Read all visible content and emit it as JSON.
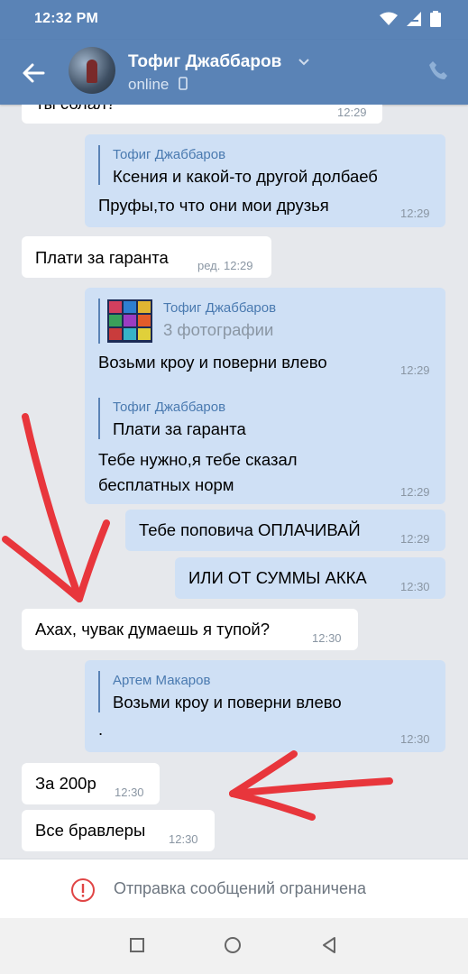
{
  "status_bar": {
    "time": "12:32 PM"
  },
  "header": {
    "name": "Тофиг Джаббаров",
    "status": "online"
  },
  "messages": {
    "m0": {
      "text": "ты сблал?",
      "time": "12:29"
    },
    "m1": {
      "quote_author": "Тофиг Джаббаров",
      "quote_text": "Ксения  и какой-то другой долбаеб",
      "text": "Пруфы,то что они мои друзья",
      "time": "12:29"
    },
    "m2": {
      "text": "Плати за гаранта",
      "time": "ред. 12:29"
    },
    "m3": {
      "quote_author": "Тофиг Джаббаров",
      "quote_text": "3 фотографии",
      "text": "Возьми кроу и поверни влево",
      "time": "12:29"
    },
    "m4": {
      "quote_author": "Тофиг Джаббаров",
      "quote_text": "Плати за гаранта",
      "text_line1": "Тебе нужно,я тебе сказал",
      "text_line2": "бесплатных норм",
      "time": "12:29"
    },
    "m5": {
      "text": "Тебе поповича ОПЛАЧИВАЙ",
      "time": "12:29"
    },
    "m6": {
      "text": "ИЛИ ОТ СУММЫ АККА",
      "time": "12:30"
    },
    "m7": {
      "text": "Ахах, чувак думаешь я тупой?",
      "time": "12:30"
    },
    "m8": {
      "quote_author": "Артем Макаров",
      "quote_text": "Возьми кроу и поверни влево",
      "text": ".",
      "time": "12:30"
    },
    "m9": {
      "text": "За 200р",
      "time": "12:30"
    },
    "m10": {
      "text": "Все бравлеры",
      "time": "12:30"
    }
  },
  "footer": {
    "restriction": "Отправка сообщений ограничена"
  },
  "colors": {
    "header": "#5a83b6",
    "outgoing_bubble": "#cfe0f5",
    "incoming_bubble": "#ffffff",
    "background": "#e6e8ec",
    "annotation_arrow": "#e8363c",
    "alert": "#e04545"
  },
  "icons": [
    "wifi-icon",
    "signal-icon",
    "battery-icon",
    "back-arrow-icon",
    "chevron-down-icon",
    "phone-icon",
    "mobile-icon",
    "alert-icon",
    "square-nav-icon",
    "circle-nav-icon",
    "triangle-nav-icon"
  ]
}
